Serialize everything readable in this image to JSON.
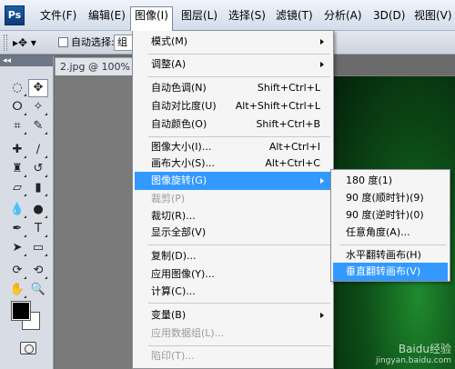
{
  "app": {
    "logo": "Ps"
  },
  "menubar": {
    "items": [
      "文件(F)",
      "编辑(E)",
      "图像(I)",
      "图层(L)",
      "选择(S)",
      "滤镜(T)",
      "分析(A)",
      "3D(D)",
      "视图(V)"
    ]
  },
  "options": {
    "auto_select_label": "自动选择:",
    "auto_select_value": "组"
  },
  "document": {
    "tab_label": "2.jpg @ 100% (图"
  },
  "image_menu": {
    "mode": "模式(M)",
    "adjust": "调整(A)",
    "auto_tone": {
      "label": "自动色调(N)",
      "shortcut": "Shift+Ctrl+L"
    },
    "auto_contrast": {
      "label": "自动对比度(U)",
      "shortcut": "Alt+Shift+Ctrl+L"
    },
    "auto_color": {
      "label": "自动颜色(O)",
      "shortcut": "Shift+Ctrl+B"
    },
    "image_size": {
      "label": "图像大小(I)...",
      "shortcut": "Alt+Ctrl+I"
    },
    "canvas_size": {
      "label": "画布大小(S)...",
      "shortcut": "Alt+Ctrl+C"
    },
    "rotate": "图像旋转(G)",
    "crop": "裁剪(P)",
    "trim": "裁切(R)...",
    "reveal_all": "显示全部(V)",
    "duplicate": "复制(D)...",
    "apply_image": "应用图像(Y)...",
    "calculations": "计算(C)...",
    "variables": "变量(B)",
    "apply_data_set": "应用数据组(L)...",
    "trap": "陷印(T)..."
  },
  "rotate_submenu": {
    "rotate_180": "180 度(1)",
    "rotate_90_cw": "90 度(顺时针)(9)",
    "rotate_90_ccw": "90 度(逆时针)(0)",
    "arbitrary": "任意角度(A)...",
    "flip_horizontal": "水平翻转画布(H)",
    "flip_vertical": "垂直翻转画布(V)"
  },
  "colors": {
    "highlight": "#3399ff",
    "fg": "#000000",
    "bg": "#ffffff"
  },
  "watermark": {
    "line1": "Baidu经验",
    "line2": "jingyan.baidu.com"
  }
}
